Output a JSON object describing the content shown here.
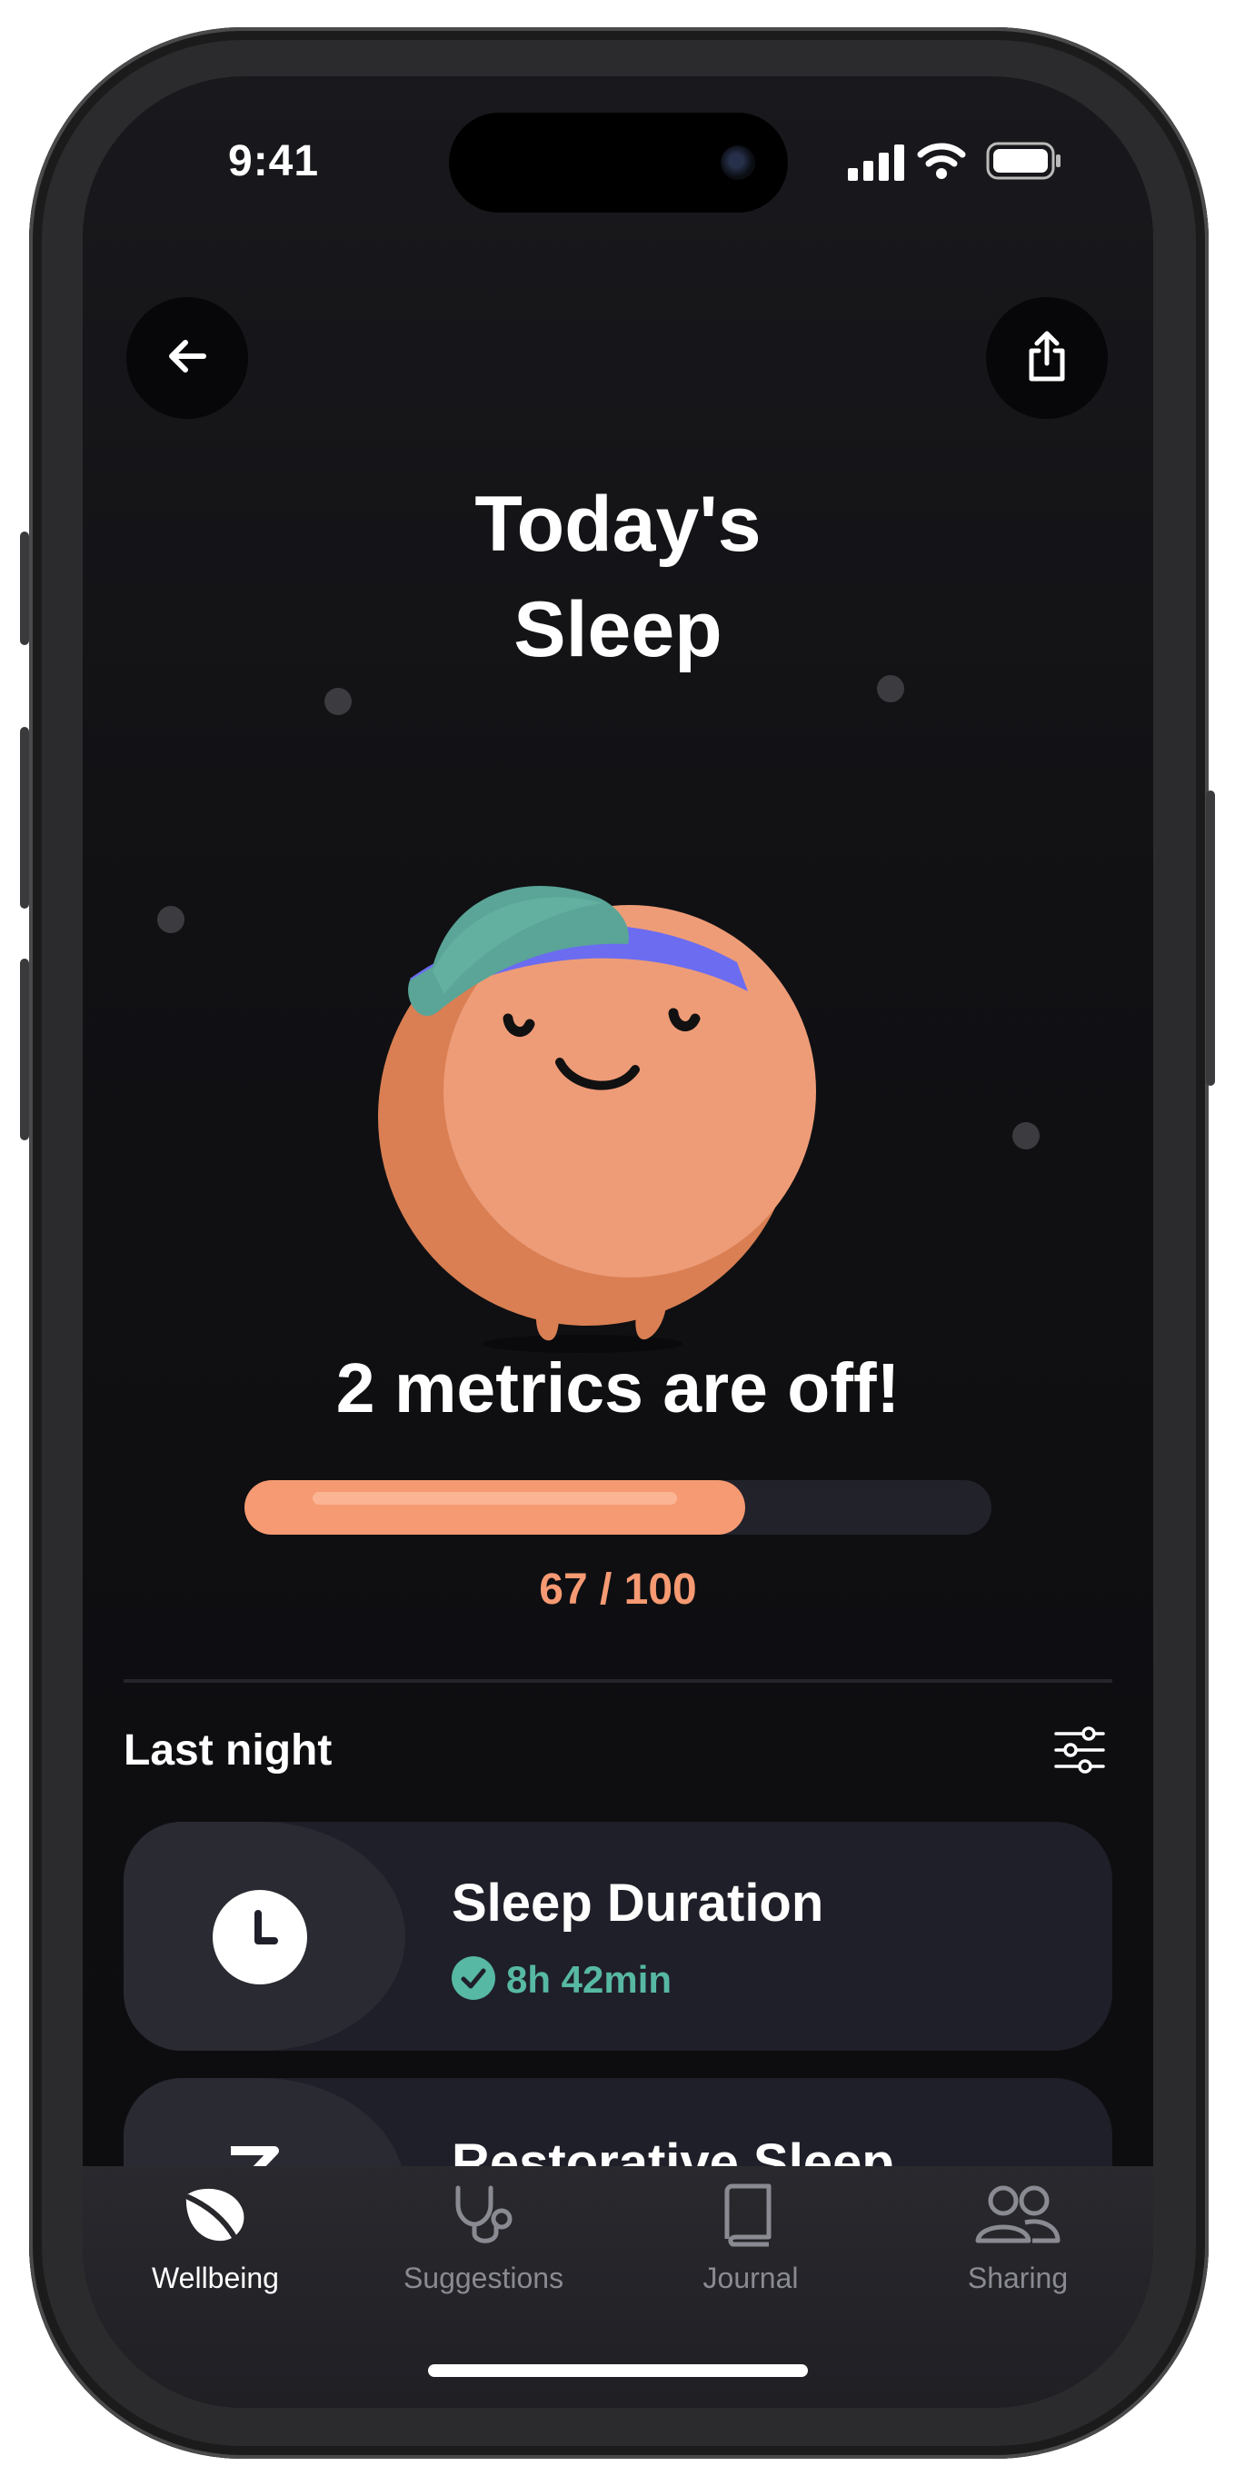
{
  "status_bar": {
    "time": "9:41"
  },
  "header": {
    "back_icon": "arrow-left-icon",
    "share_icon": "share-icon"
  },
  "title": {
    "line1": "Today's",
    "line2": "Sleep"
  },
  "mascot": {
    "name": "sleep-mascot-illustration"
  },
  "summary": {
    "headline": "2 metrics are off!",
    "score_text": "67 / 100",
    "score": 67,
    "score_max": 100
  },
  "section": {
    "label": "Last night",
    "filter_icon": "sliders-icon"
  },
  "cards": [
    {
      "title": "Sleep Duration",
      "value": "8h 42min",
      "icon": "clock-icon",
      "status_icon": "check-circle-icon"
    },
    {
      "title": "Restorative Sleep",
      "icon": "z-icon"
    }
  ],
  "tabs": [
    {
      "label": "Wellbeing",
      "icon": "leaf-icon",
      "active": true
    },
    {
      "label": "Suggestions",
      "icon": "stethoscope-icon",
      "active": false
    },
    {
      "label": "Journal",
      "icon": "book-icon",
      "active": false
    },
    {
      "label": "Sharing",
      "icon": "people-icon",
      "active": false
    }
  ],
  "colors": {
    "accent": "#f59a72",
    "success": "#57b8a3",
    "background": "#111114",
    "card": "#1f1f29",
    "tab_inactive": "#8a8a92"
  }
}
